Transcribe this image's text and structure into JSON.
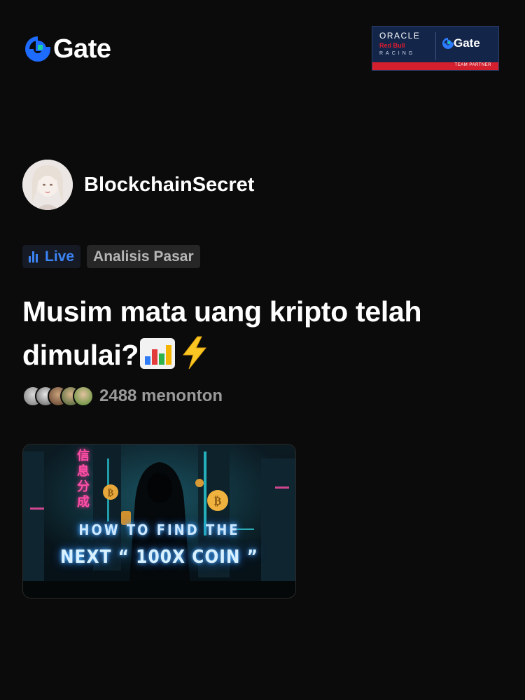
{
  "brand": {
    "name": "Gate",
    "accent": "#1e6bff",
    "accent_green": "#19d39d"
  },
  "partner_badge": {
    "line1": "ORACLE",
    "line2": "Red Bull",
    "line3": "RACING",
    "brand": "Gate",
    "footer": "TEAM PARTNER"
  },
  "post": {
    "author": "BlockchainSecret",
    "tags": [
      {
        "label": "Live",
        "icon": "live-bars-icon",
        "color": "#3c84f5"
      },
      {
        "label": "Analisis Pasar"
      }
    ],
    "title": "Musim mata uang kripto telah dimulai?",
    "title_emojis": [
      "bar-chart-emoji",
      "lightning-emoji"
    ],
    "viewers": "2488 menonton",
    "thumbnail": {
      "sign_text": "信息分成",
      "line1": "HOW TO FIND THE",
      "line2": "NEXT “ 100X COIN ”"
    }
  }
}
